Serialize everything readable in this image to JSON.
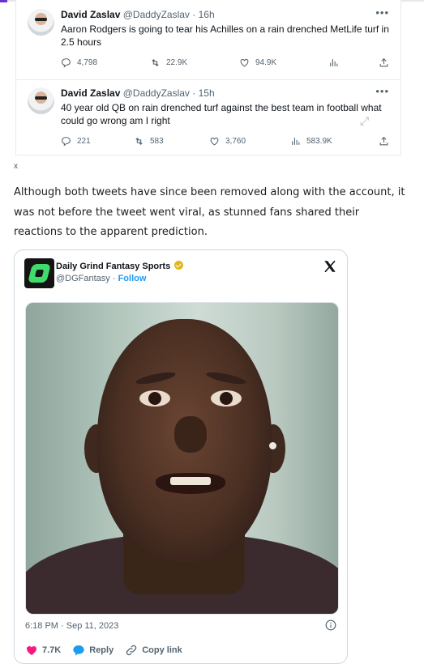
{
  "tweets": [
    {
      "name": "David Zaslav",
      "handle": "@DaddyZaslav · 16h",
      "text": "Aaron Rodgers is going to tear his Achilles on a rain drenched MetLife turf in 2.5 hours",
      "replies": "4,798",
      "retweets": "22.9K",
      "likes": "94.9K",
      "views": ""
    },
    {
      "name": "David Zaslav",
      "handle": "@DaddyZaslav · 15h",
      "text": "40 year old QB on rain drenched turf against the best team in football what could go wrong am I right",
      "replies": "221",
      "retweets": "583",
      "likes": "3,760",
      "views": "583.9K"
    }
  ],
  "close_label": "x",
  "article": {
    "paragraph": "Although both tweets have since been removed along with the account, it was not before the tweet went viral, as stunned fans shared their reactions to the apparent prediction."
  },
  "embed": {
    "account_name": "Daily Grind Fantasy Sports",
    "handle": "@DGFantasy",
    "separator": " · ",
    "follow_label": "Follow",
    "timestamp": "6:18 PM · Sep 11, 2023",
    "likes": "7.7K",
    "reply_label": "Reply",
    "copy_link_label": "Copy link"
  },
  "colors": {
    "like_pink": "#f91880",
    "reply_blue": "#1d9bf0",
    "brand_green": "#3fdb6b"
  }
}
